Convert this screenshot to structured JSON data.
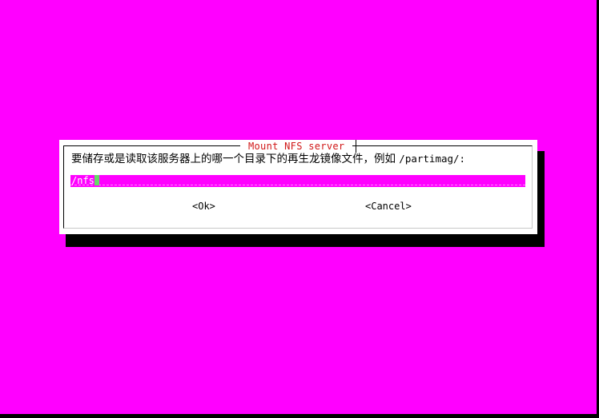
{
  "dialog": {
    "title": "Mount NFS server",
    "prompt": "要储存或是读取该服务器上的哪一个目录下的再生龙镜像文件，例如",
    "example_path": "/partimag/:",
    "input": {
      "value": "/nfs"
    },
    "buttons": {
      "ok": "<Ok>",
      "cancel": "<Cancel>"
    }
  },
  "colors": {
    "background": "#ff00ff",
    "dialog": "#ffffff",
    "title": "#d01818",
    "input_background": "#ff00ff",
    "cursor": "#66d966"
  }
}
